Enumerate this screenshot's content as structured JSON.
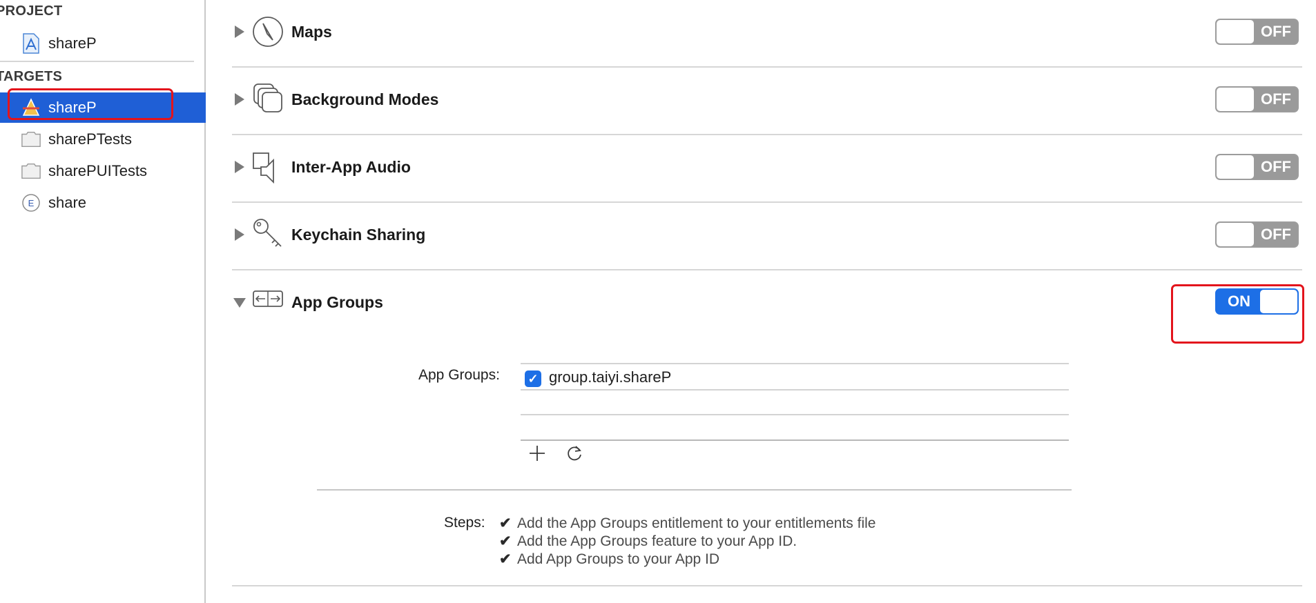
{
  "sidebar": {
    "project_header": "PROJECT",
    "project_items": [
      {
        "label": "shareP",
        "icon": "xcodeproj-file-icon"
      }
    ],
    "targets_header": "TARGETS",
    "target_items": [
      {
        "label": "shareP",
        "icon": "app-target-icon",
        "selected": true
      },
      {
        "label": "sharePTests",
        "icon": "test-bundle-icon"
      },
      {
        "label": "sharePUITests",
        "icon": "test-bundle-icon"
      },
      {
        "label": "share",
        "icon": "extension-icon"
      }
    ]
  },
  "capabilities": [
    {
      "title": "Maps",
      "icon": "compass-icon",
      "state": "OFF",
      "expanded": false
    },
    {
      "title": "Background Modes",
      "icon": "stacked-windows-icon",
      "state": "OFF",
      "expanded": false
    },
    {
      "title": "Inter-App Audio",
      "icon": "speaker-icon",
      "state": "OFF",
      "expanded": false
    },
    {
      "title": "Keychain Sharing",
      "icon": "keys-icon",
      "state": "OFF",
      "expanded": false
    },
    {
      "title": "App Groups",
      "icon": "app-groups-icon",
      "state": "ON",
      "expanded": true
    }
  ],
  "app_groups": {
    "label": "App Groups:",
    "groups": [
      {
        "name": "group.taiyi.shareP",
        "checked": true
      }
    ],
    "add_icon": "plus-icon",
    "refresh_icon": "refresh-icon"
  },
  "steps": {
    "label": "Steps:",
    "items": [
      "Add the App Groups entitlement to your entitlements file",
      "Add the App Groups feature to your App ID.",
      "Add App Groups to your App ID"
    ]
  },
  "colors": {
    "selection": "#1f5fd6",
    "toggle_on": "#1d6fe6",
    "toggle_off": "#9a9a9a",
    "highlight": "#e3141c"
  }
}
